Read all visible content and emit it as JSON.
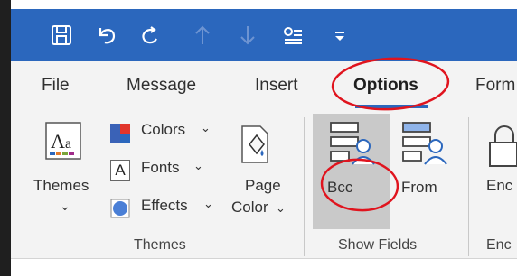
{
  "colors": {
    "accent": "#2b67bd",
    "ribbon_bg": "#f3f3f3",
    "annotation": "#e0141e",
    "selected_bg": "#c9c9c9"
  },
  "quick_access": {
    "icons": [
      "save-icon",
      "undo-icon",
      "redo-icon",
      "up-arrow-icon",
      "down-arrow-icon",
      "touch-mode-icon",
      "customize-qat-icon"
    ]
  },
  "tabs": [
    {
      "label": "File"
    },
    {
      "label": "Message"
    },
    {
      "label": "Insert"
    },
    {
      "label": "Options",
      "active": true
    },
    {
      "label": "Form"
    }
  ],
  "ribbon": {
    "themes_group": {
      "themes_label": "Themes",
      "themes_dropdown": "⌄",
      "colors_label": "Colors",
      "fonts_label": "Fonts",
      "effects_label": "Effects",
      "page_color_label_line1": "Page",
      "page_color_label_line2": "Color",
      "group_label": "Themes"
    },
    "show_fields_group": {
      "bcc_label": "Bcc",
      "from_label": "From",
      "group_label": "Show Fields"
    },
    "encrypt_group": {
      "button_label": "Enc",
      "group_label": "Enc"
    }
  }
}
